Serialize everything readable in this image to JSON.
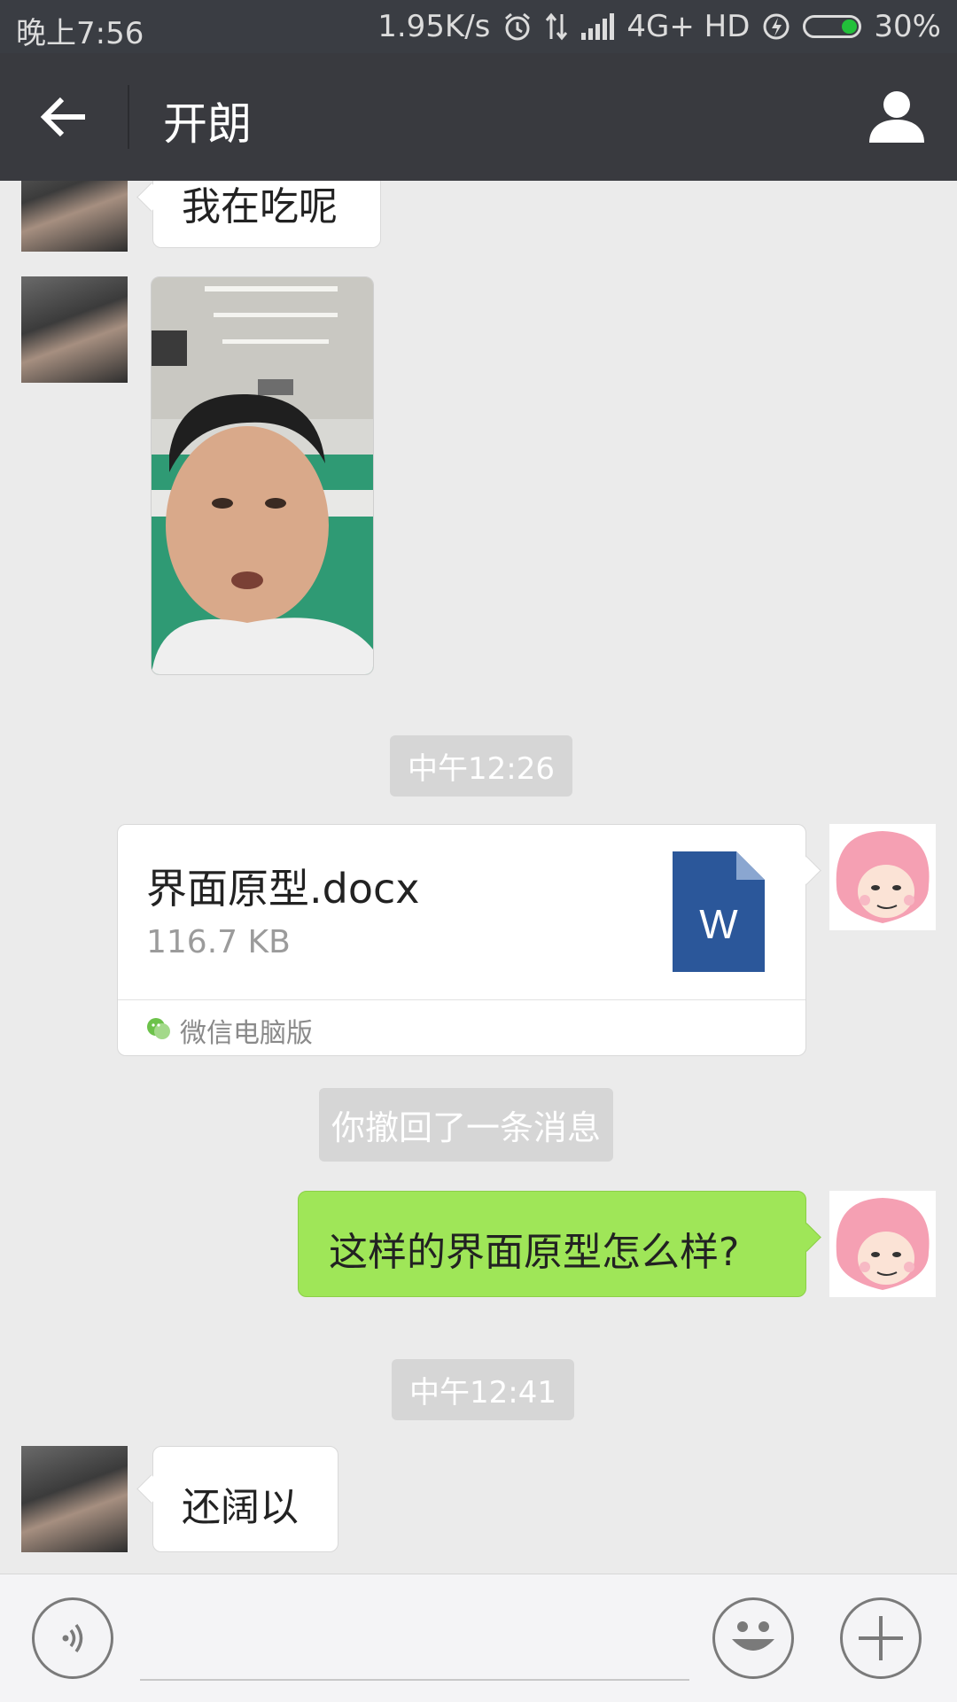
{
  "status_bar": {
    "time": "晚上7:56",
    "net_speed": "1.95K/s",
    "network": "4G+ HD",
    "battery": "30%",
    "battery_level": 0.3,
    "battery_color": "#22c03a"
  },
  "header": {
    "title": "开朗",
    "back_icon": "arrow-left-icon",
    "profile_icon": "person-icon"
  },
  "messages": {
    "m1_text": "我在吃呢",
    "time1": "中午12:26",
    "file": {
      "name": "界面原型.docx",
      "size": "116.7 KB",
      "icon_letter": "W",
      "source": "微信电脑版",
      "icon_color": "#2b579a"
    },
    "recall": "你撤回了一条消息",
    "m_green": "这样的界面原型怎么样?",
    "time2": "中午12:41",
    "m_last": "还阔以"
  },
  "bottom_bar": {
    "voice_icon": "voice-icon",
    "emoji_icon": "emoji-icon",
    "plus_icon": "plus-icon"
  },
  "colors": {
    "header_bg": "#393a3f",
    "chat_bg": "#ebebeb",
    "green_bubble": "#9fe658"
  }
}
